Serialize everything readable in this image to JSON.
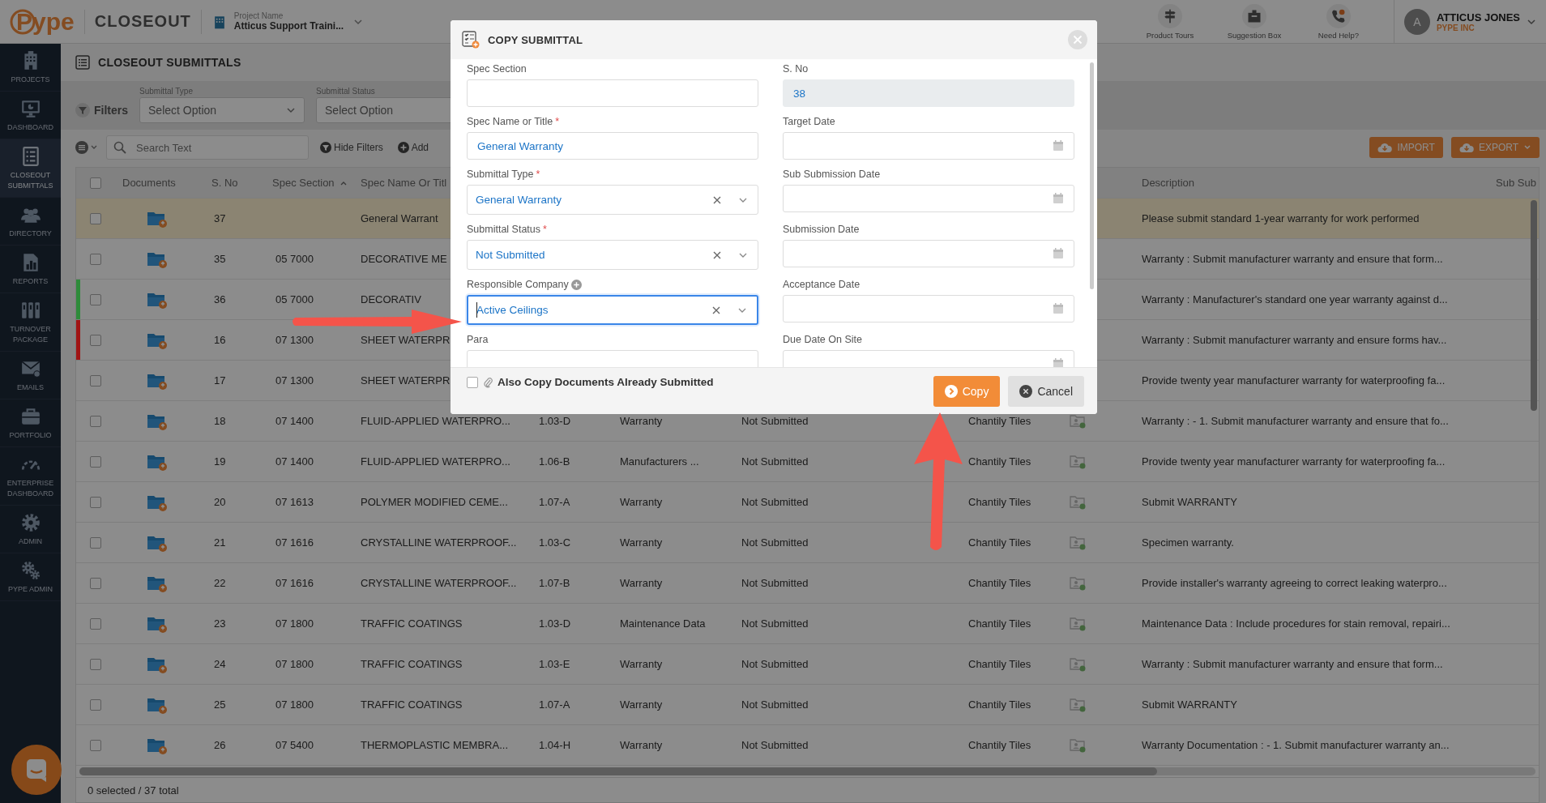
{
  "topbar": {
    "logo": "Pype",
    "app": "CLOSEOUT",
    "project_label": "Project Name",
    "project": "Atticus Support Traini...",
    "tools": [
      {
        "label": "Product Tours"
      },
      {
        "label": "Suggestion Box"
      },
      {
        "label": "Need Help?"
      }
    ],
    "user": {
      "initial": "A",
      "name": "ATTICUS JONES",
      "company": "PYPE INC"
    }
  },
  "sidebar": {
    "items": [
      {
        "label": "PROJECTS",
        "selected": false
      },
      {
        "label": "DASHBOARD",
        "selected": false
      },
      {
        "label": "CLOSEOUT SUBMITTALS",
        "selected": true
      },
      {
        "label": "DIRECTORY",
        "selected": false
      },
      {
        "label": "REPORTS",
        "selected": false
      },
      {
        "label": "TURNOVER PACKAGE",
        "selected": false
      },
      {
        "label": "EMAILS",
        "selected": false
      },
      {
        "label": "PORTFOLIO",
        "selected": false
      },
      {
        "label": "ENTERPRISE DASHBOARD",
        "selected": false
      },
      {
        "label": "ADMIN",
        "selected": false
      },
      {
        "label": "PYPE ADMIN",
        "selected": false
      }
    ]
  },
  "page": {
    "title": "CLOSEOUT SUBMITTALS"
  },
  "filters": {
    "label": "Filters",
    "fields": [
      {
        "label": "Submittal Type",
        "placeholder": "Select Option"
      },
      {
        "label": "Submittal Status",
        "placeholder": "Select Option"
      }
    ]
  },
  "toolbar": {
    "search_placeholder": "Search Text",
    "actions": [
      {
        "label": "Hide Filters"
      },
      {
        "label": "Add"
      }
    ],
    "buttons": [
      {
        "label": "IMPORT",
        "kind": "import"
      },
      {
        "label": "EXPORT",
        "kind": "export"
      }
    ]
  },
  "table": {
    "all_selected": false,
    "columns": [
      {
        "label": "Documents",
        "sorted": false
      },
      {
        "label": "S. No",
        "sorted": false
      },
      {
        "label": "Spec Section",
        "sorted": true
      },
      {
        "label": "Spec Name Or Titl",
        "sorted": false
      },
      {
        "label": "Description",
        "sorted": false
      },
      {
        "label": "Sub Sub",
        "sorted": false
      }
    ],
    "rows": [
      {
        "selected": false,
        "highlighted": true,
        "s_no": "37",
        "spec_name": "General Warrant",
        "description": "Please submit standard 1-year warranty for work performed"
      },
      {
        "selected": false,
        "highlighted": false,
        "s_no": "35",
        "spec_section": "05 7000",
        "spec_name": "DECORATIVE ME",
        "description": "Warranty : Submit manufacturer warranty and ensure that form..."
      },
      {
        "selected": false,
        "highlighted": false,
        "color": "#2e8b3a",
        "s_no": "36",
        "spec_section": "05 7000",
        "spec_name": "DECORATIV",
        "description": "Warranty : Manufacturer's standard one year warranty against d..."
      },
      {
        "selected": false,
        "highlighted": false,
        "color": "#a01414",
        "s_no": "16",
        "spec_section": "07 1300",
        "spec_name": "SHEET WATERPR",
        "description": "Warranty : Submit manufacturer warranty and ensure forms hav..."
      },
      {
        "selected": false,
        "highlighted": false,
        "s_no": "17",
        "spec_section": "07 1300",
        "spec_name": "SHEET WATERPR",
        "description": "Provide twenty year manufacturer warranty for waterproofing fa..."
      },
      {
        "selected": false,
        "highlighted": false,
        "s_no": "18",
        "spec_section": "07 1400",
        "spec_name": "FLUID-APPLIED WATERPRO...",
        "para": "1.03-D",
        "type": "Warranty",
        "status": "Not Submitted",
        "company": "Chantily Tiles",
        "description": "Warranty : - 1. Submit manufacturer warranty and ensure that fo..."
      },
      {
        "selected": false,
        "highlighted": false,
        "s_no": "19",
        "spec_section": "07 1400",
        "spec_name": "FLUID-APPLIED WATERPRO...",
        "para": "1.06-B",
        "type": "Manufacturers ...",
        "status": "Not Submitted",
        "company": "Chantily Tiles",
        "description": "Provide twenty year manufacturer warranty for waterproofing fa..."
      },
      {
        "selected": false,
        "highlighted": false,
        "s_no": "20",
        "spec_section": "07 1613",
        "spec_name": "POLYMER MODIFIED CEME...",
        "para": "1.07-A",
        "type": "Warranty",
        "status": "Not Submitted",
        "company": "Chantily Tiles",
        "description": "Submit WARRANTY"
      },
      {
        "selected": false,
        "highlighted": false,
        "s_no": "21",
        "spec_section": "07 1616",
        "spec_name": "CRYSTALLINE WATERPROOF...",
        "para": "1.03-C",
        "type": "Warranty",
        "status": "Not Submitted",
        "company": "Chantily Tiles",
        "description": "Specimen warranty."
      },
      {
        "selected": false,
        "highlighted": false,
        "s_no": "22",
        "spec_section": "07 1616",
        "spec_name": "CRYSTALLINE WATERPROOF...",
        "para": "1.07-B",
        "type": "Warranty",
        "status": "Not Submitted",
        "company": "Chantily Tiles",
        "description": "Provide installer's warranty agreeing to correct leaking waterpro..."
      },
      {
        "selected": false,
        "highlighted": false,
        "s_no": "23",
        "spec_section": "07 1800",
        "spec_name": "TRAFFIC COATINGS",
        "para": "1.03-D",
        "type": "Maintenance Data",
        "status": "Not Submitted",
        "company": "Chantily Tiles",
        "description": "Maintenance Data : Include procedures for stain removal, repairi..."
      },
      {
        "selected": false,
        "highlighted": false,
        "s_no": "24",
        "spec_section": "07 1800",
        "spec_name": "TRAFFIC COATINGS",
        "para": "1.03-E",
        "type": "Warranty",
        "status": "Not Submitted",
        "company": "Chantily Tiles",
        "description": "Warranty : Submit manufacturer warranty and ensure that form..."
      },
      {
        "selected": false,
        "highlighted": false,
        "s_no": "25",
        "spec_section": "07 1800",
        "spec_name": "TRAFFIC COATINGS",
        "para": "1.07-A",
        "type": "Warranty",
        "status": "Not Submitted",
        "company": "Chantily Tiles",
        "description": "Submit WARRANTY"
      },
      {
        "selected": false,
        "highlighted": false,
        "s_no": "26",
        "spec_section": "07 5400",
        "spec_name": "THERMOPLASTIC MEMBRA...",
        "para": "1.04-H",
        "type": "Warranty",
        "status": "Not Submitted",
        "company": "Chantily Tiles",
        "description": "Warranty Documentation : - 1. Submit manufacturer warranty an..."
      }
    ]
  },
  "status_bar": "0 selected / 37 total",
  "modal": {
    "title": "COPY SUBMITTAL",
    "fields": [
      {
        "label": "Spec Section",
        "kind": "text"
      },
      {
        "label": "S. No",
        "kind": "readonly",
        "value": "38"
      },
      {
        "label": "Spec Name or Title",
        "required_mark": "*",
        "kind": "text",
        "value": "General Warranty"
      },
      {
        "label": "Target Date",
        "kind": "date"
      },
      {
        "label": "Submittal Type",
        "required_mark": "*",
        "kind": "select",
        "value": "General Warranty"
      },
      {
        "label": "Sub Submission Date",
        "kind": "date"
      },
      {
        "label": "Submittal Status",
        "required_mark": "*",
        "kind": "select",
        "value": "Not Submitted"
      },
      {
        "label": "Submission Date",
        "kind": "date"
      },
      {
        "label": "Responsible Company",
        "kind": "select",
        "value": "Active Ceilings",
        "addable": true,
        "focused": true
      },
      {
        "label": "Acceptance Date",
        "kind": "date"
      },
      {
        "label": "Para",
        "kind": "text"
      },
      {
        "label": "Due Date On Site",
        "kind": "date"
      }
    ],
    "copy_documents": {
      "label": "Also Copy Documents Already Submitted",
      "checked": false
    },
    "buttons": [
      {
        "label": "Copy",
        "kind": "primary"
      },
      {
        "label": "Cancel",
        "kind": "secondary"
      }
    ]
  }
}
